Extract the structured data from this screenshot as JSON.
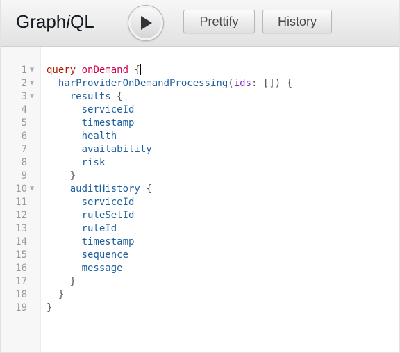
{
  "app": {
    "title_prefix": "Graph",
    "title_italic": "i",
    "title_suffix": "QL"
  },
  "toolbar": {
    "execute_icon": "play-icon",
    "prettify_label": "Prettify",
    "history_label": "History"
  },
  "editor": {
    "fold_icon": "fold-arrow-icon",
    "lines": [
      {
        "n": "1",
        "fold": true
      },
      {
        "n": "2",
        "fold": true
      },
      {
        "n": "3",
        "fold": true
      },
      {
        "n": "4",
        "fold": false
      },
      {
        "n": "5",
        "fold": false
      },
      {
        "n": "6",
        "fold": false
      },
      {
        "n": "7",
        "fold": false
      },
      {
        "n": "8",
        "fold": false
      },
      {
        "n": "9",
        "fold": false
      },
      {
        "n": "10",
        "fold": true
      },
      {
        "n": "11",
        "fold": false
      },
      {
        "n": "12",
        "fold": false
      },
      {
        "n": "13",
        "fold": false
      },
      {
        "n": "14",
        "fold": false
      },
      {
        "n": "15",
        "fold": false
      },
      {
        "n": "16",
        "fold": false
      },
      {
        "n": "17",
        "fold": false
      },
      {
        "n": "18",
        "fold": false
      },
      {
        "n": "19",
        "fold": false
      }
    ],
    "tokens": {
      "query_keyword": "query",
      "operation_name": "onDemand",
      "root_field": "harProviderOnDemandProcessing",
      "arg_name": "ids",
      "arg_value": "[]",
      "results_field": "results",
      "results_fields": [
        "serviceId",
        "timestamp",
        "health",
        "availability",
        "risk"
      ],
      "audit_field": "auditHistory",
      "audit_fields": [
        "serviceId",
        "ruleSetId",
        "ruleId",
        "timestamp",
        "sequence",
        "message"
      ],
      "open_brace": "{",
      "close_brace": "}",
      "open_paren": "(",
      "close_paren_brace": ") {",
      "colon": ":"
    }
  },
  "colors": {
    "keyword": "#b11a04",
    "definition": "#d2054e",
    "field": "#1f61a0",
    "argument": "#8b2bb9",
    "line_number": "#999999"
  }
}
